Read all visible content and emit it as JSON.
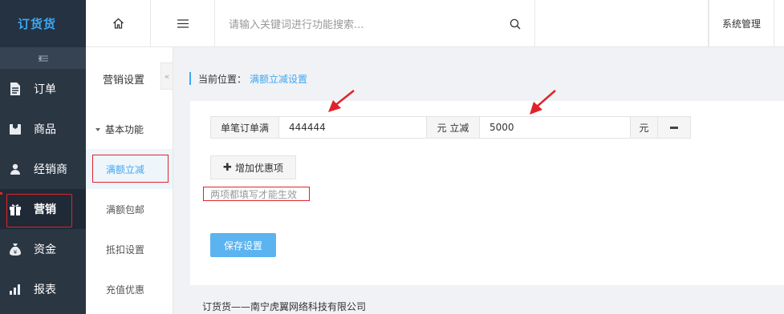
{
  "app": {
    "logo": "订货货"
  },
  "sidebar": {
    "items": [
      {
        "label": "订单",
        "icon": "document-icon"
      },
      {
        "label": "商品",
        "icon": "package-icon"
      },
      {
        "label": "经销商",
        "icon": "user-icon"
      },
      {
        "label": "营销",
        "icon": "gift-icon",
        "active": true
      },
      {
        "label": "资金",
        "icon": "money-bag-icon"
      },
      {
        "label": "报表",
        "icon": "bar-chart-icon"
      }
    ]
  },
  "topbar": {
    "search_placeholder": "请输入关键词进行功能搜索...",
    "system_manage": "系统管理"
  },
  "submenu": {
    "title": "营销设置",
    "group": "基本功能",
    "items": [
      {
        "label": "满额立减",
        "active": true
      },
      {
        "label": "满额包邮"
      },
      {
        "label": "抵扣设置"
      },
      {
        "label": "充值优惠"
      }
    ]
  },
  "breadcrumb": {
    "label": "当前位置：",
    "current": "满额立减设置"
  },
  "rule": {
    "prefix": "单笔订单满",
    "threshold": "444444",
    "middle": "元 立减",
    "amount": "5000",
    "unit": "元"
  },
  "add_button": "增加优惠项",
  "hint": "两项都填写才能生效",
  "save_button": "保存设置",
  "footer": "订货货——南宁虎翼网络科技有限公司",
  "colors": {
    "accent": "#3fa7f2",
    "sidebar_bg": "#2b3643",
    "annotation_red": "#e0232a"
  }
}
